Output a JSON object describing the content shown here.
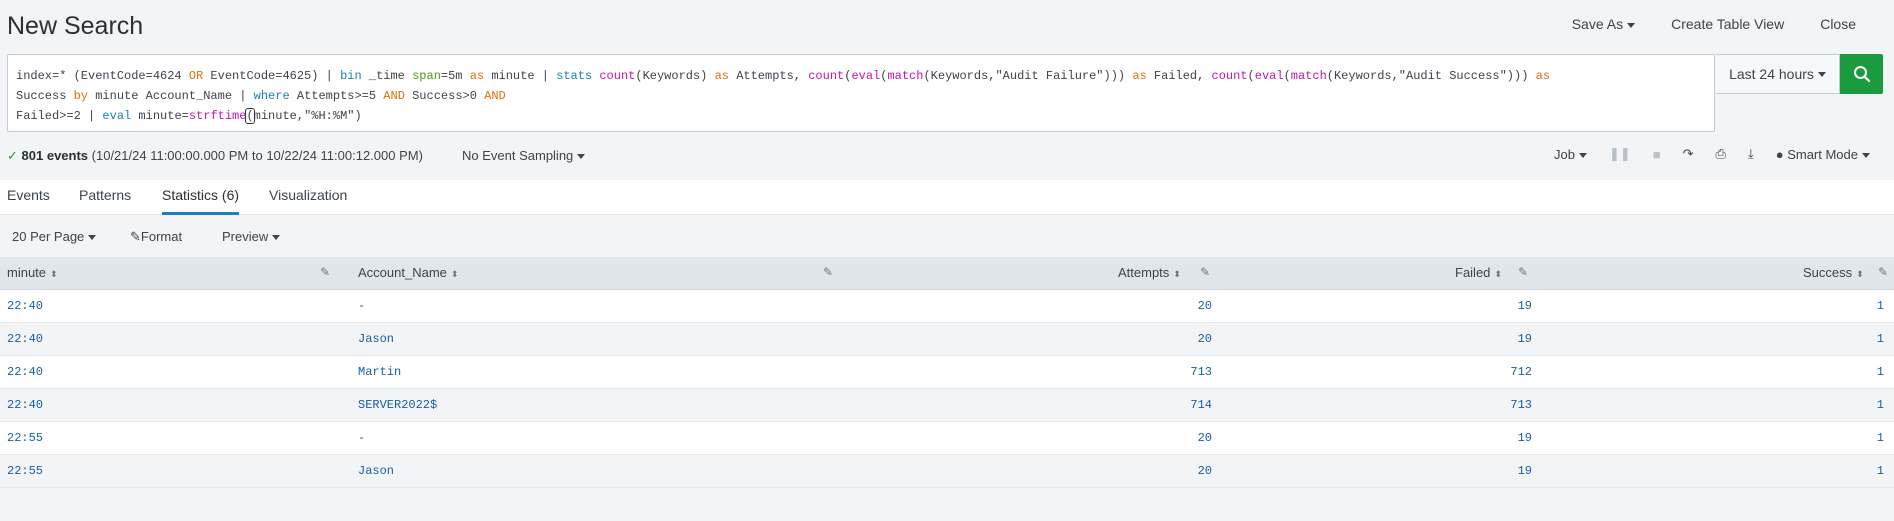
{
  "header": {
    "title": "New Search",
    "actions": [
      "Save As",
      "Create Table View",
      "Close"
    ]
  },
  "search": {
    "line1_a": "index=* (EventCode=4624 ",
    "line1_or": "OR",
    "line1_b": " EventCode=4625) | ",
    "line1_bin": "bin",
    "line1_c": " _time ",
    "line1_span": "span",
    "line1_d": "=5m ",
    "line1_as1": "as",
    "line1_e": " minute | ",
    "line1_stats": "stats",
    "line1_f": " ",
    "line1_count1": "count",
    "line1_g": "(Keywords) ",
    "line1_as2": "as",
    "line1_h": " Attempts, ",
    "line1_count2": "count",
    "line1_i": "(",
    "line1_eval1": "eval",
    "line1_j": "(",
    "line1_match1": "match",
    "line1_k": "(Keywords,\"Audit Failure\"))) ",
    "line1_as3": "as",
    "line1_l": " Failed, ",
    "line1_count3": "count",
    "line1_m": "(",
    "line1_eval2": "eval",
    "line1_n": "(",
    "line1_match2": "match",
    "line1_o": "(Keywords,\"Audit Success\"))) ",
    "line1_as4": "as",
    "line2_a": "Success ",
    "line2_by": "by",
    "line2_b": " minute Account_Name | ",
    "line2_where": "where",
    "line2_c": " Attempts>=5 ",
    "line2_and1": "AND",
    "line2_d": " Success>0 ",
    "line2_and2": "AND",
    "line3_a": "Failed>=2 | ",
    "line3_eval": "eval",
    "line3_b": " minute=",
    "line3_strftime": "strftime",
    "line3_paren": "(",
    "line3_c": "minute,\"%H:%M\")",
    "time_range": "Last 24 hours"
  },
  "status": {
    "count": "801 events",
    "range": "(10/21/24 11:00:00.000 PM to 10/22/24 11:00:12.000 PM)",
    "sampling": "No Event Sampling",
    "job": "Job",
    "mode": "Smart Mode"
  },
  "tabs": [
    "Events",
    "Patterns",
    "Statistics (6)",
    "Visualization"
  ],
  "toolbar": {
    "per_page": "20 Per Page",
    "format": "Format",
    "preview": "Preview"
  },
  "table": {
    "columns": [
      "minute",
      "Account_Name",
      "Attempts",
      "Failed",
      "Success"
    ],
    "rows": [
      [
        "22:40",
        "-",
        "20",
        "19",
        "1"
      ],
      [
        "22:40",
        "Jason",
        "20",
        "19",
        "1"
      ],
      [
        "22:40",
        "Martin",
        "713",
        "712",
        "1"
      ],
      [
        "22:40",
        "SERVER2022$",
        "714",
        "713",
        "1"
      ],
      [
        "22:55",
        "-",
        "20",
        "19",
        "1"
      ],
      [
        "22:55",
        "Jason",
        "20",
        "19",
        "1"
      ]
    ]
  },
  "colors": {
    "accent": "#1a7fc3",
    "search_button": "#1a9c3e",
    "link_value": "#1a5fa0"
  }
}
